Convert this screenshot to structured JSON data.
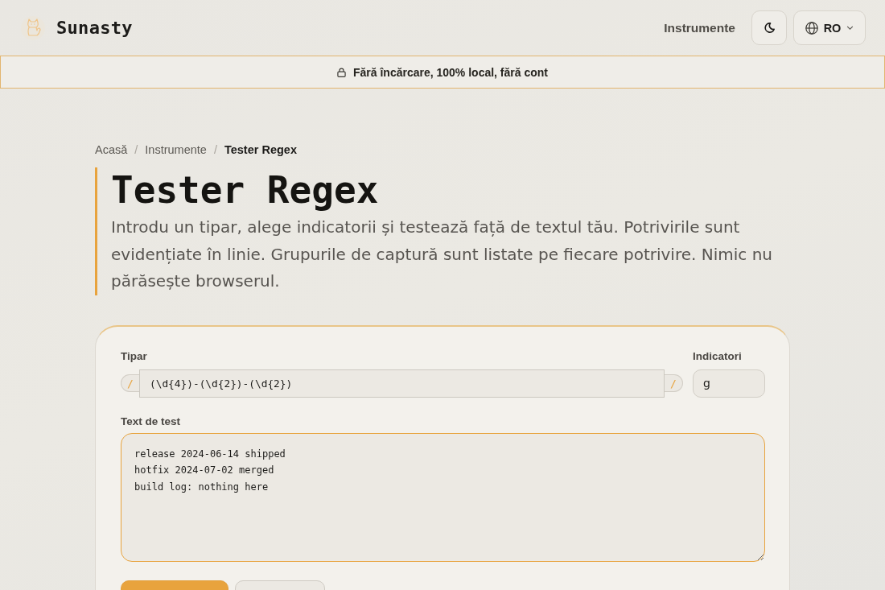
{
  "header": {
    "brand": "Sunasty",
    "nav_link": "Instrumente",
    "language": {
      "code": "RO"
    }
  },
  "banner": {
    "text": "Fără încărcare, 100% local, fără cont"
  },
  "breadcrumb": [
    {
      "label": "Acasă",
      "current": false
    },
    {
      "label": "Instrumente",
      "current": false,
      "separator": "/"
    },
    {
      "label": "Tester Regex",
      "current": true,
      "separator": "/"
    }
  ],
  "page": {
    "title": "Tester Regex",
    "description": "Introdu un tipar, alege indicatorii și testează față de textul tău. Potrivirile sunt evidențiate în linie. Grupurile de captură sunt listate pe fiecare potrivire. Nimic nu părăsește browserul."
  },
  "form": {
    "pattern": {
      "label": "Tipar",
      "delimiter_open": "/",
      "value": "(\\d{4})-(\\d{2})-(\\d{2})",
      "delimiter_close": "/",
      "focused": false
    },
    "flags": {
      "label": "Indicatori",
      "value": "g",
      "focused": false
    },
    "test_text": {
      "label": "Text de test",
      "value": "release 2024-06-14 shipped\nhotfix 2024-07-02 merged\nbuild log: nothing here",
      "focused": true
    },
    "buttons": [
      {
        "kind": "primary"
      },
      {
        "kind": "secondary"
      }
    ]
  }
}
